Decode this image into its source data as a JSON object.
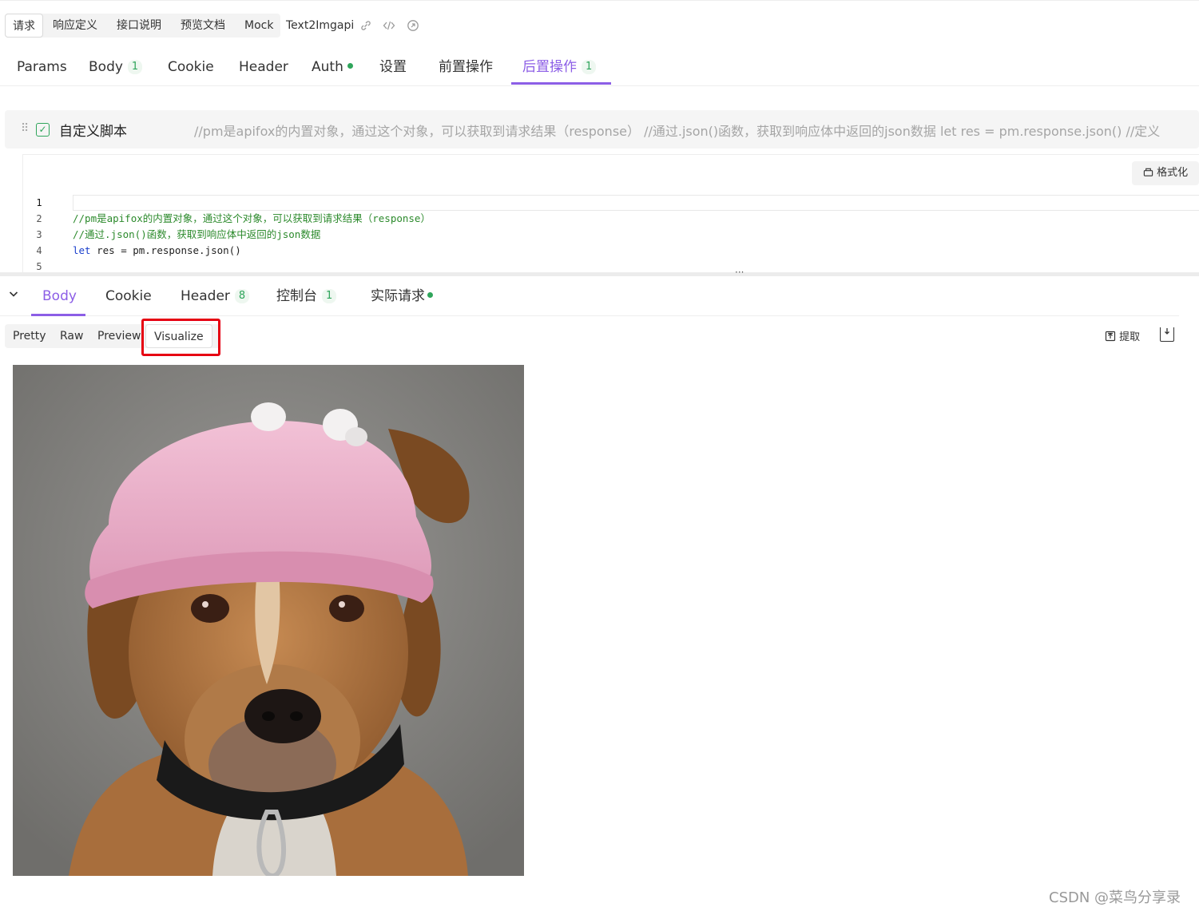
{
  "doc_tabs": {
    "items": [
      "请求",
      "响应定义",
      "接口说明",
      "预览文档",
      "Mock"
    ],
    "active": "请求",
    "api_name": "Text2Imgapi"
  },
  "request_tabs": {
    "params": "Params",
    "body": "Body",
    "body_count": "1",
    "cookie": "Cookie",
    "header": "Header",
    "auth": "Auth",
    "settings": "设置",
    "pre_ops": "前置操作",
    "post_ops": "后置操作",
    "post_ops_count": "1",
    "active": "后置操作"
  },
  "script": {
    "title": "自定义脚本",
    "preview": "//pm是apifox的内置对象，通过这个对象，可以获取到请求结果（response） //通过.json()函数，获取到响应体中返回的json数据 let res = pm.response.json() //定义",
    "format_label": "格式化",
    "line_numbers": [
      "1",
      "2",
      "3",
      "4",
      "5"
    ],
    "line2": "//pm是apifox的内置对象，通过这个对象，可以获取到请求结果（response）",
    "line3": "//通过.json()函数，获取到响应体中返回的json数据",
    "line4_kw": "let",
    "line4_rest": " res = pm.response.json()"
  },
  "splitter_dots": "···",
  "response_tabs": {
    "body": "Body",
    "cookie": "Cookie",
    "header": "Header",
    "header_count": "8",
    "console": "控制台",
    "console_count": "1",
    "actual_request": "实际请求",
    "active": "Body"
  },
  "view_modes": {
    "pretty": "Pretty",
    "raw": "Raw",
    "preview": "Preview",
    "visualize": "Visualize",
    "active": "Visualize"
  },
  "actions": {
    "extract": "提取"
  },
  "watermark": "CSDN @菜鸟分享录",
  "colors": {
    "accent": "#8c5ee6",
    "success": "#2fa55b",
    "highlight": "#e60012"
  }
}
